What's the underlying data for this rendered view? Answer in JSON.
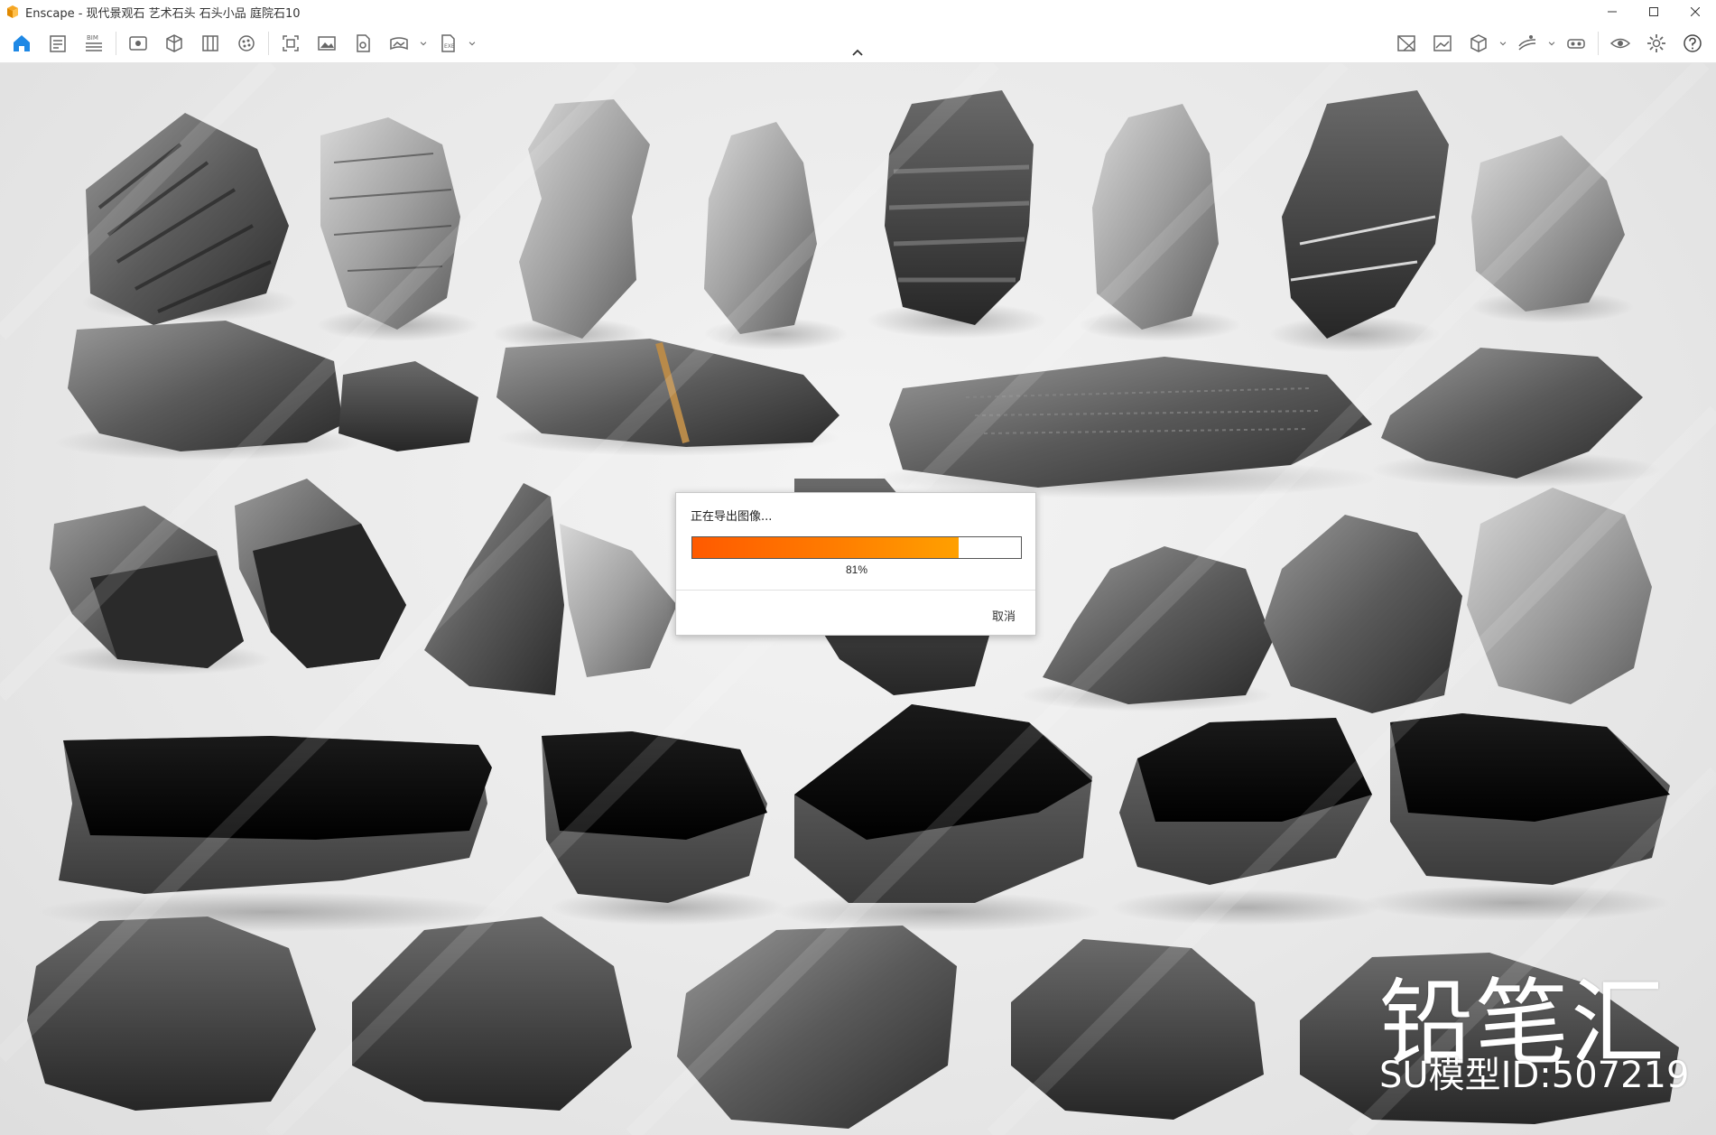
{
  "window": {
    "title": "Enscape - 现代景观石 艺术石头 石头小品 庭院石10",
    "controls": [
      "minimize-icon",
      "maximize-icon",
      "close-icon"
    ]
  },
  "toolbar": {
    "bim_label": "BIM",
    "left_icons": [
      "home-icon",
      "notes-icon",
      "bim-icon",
      "view-icon",
      "box-icon",
      "book-icon",
      "material-icon",
      "screenshot-icon",
      "image-icon",
      "render-icon",
      "panorama-icon",
      "export-icon"
    ],
    "right_icons": [
      "map-icon",
      "image-view-icon",
      "cube-icon",
      "sky-icon",
      "vr-icon",
      "visibility-icon",
      "settings-icon",
      "help-icon"
    ],
    "accent_color": "#1e88e5"
  },
  "watermark": {
    "brand": "铅笔汇",
    "model_id": "SU模型ID:507219"
  },
  "dialog": {
    "title": "正在导出图像...",
    "progress": 0.81,
    "progress_label": "81%",
    "cancel_label": "取消"
  }
}
